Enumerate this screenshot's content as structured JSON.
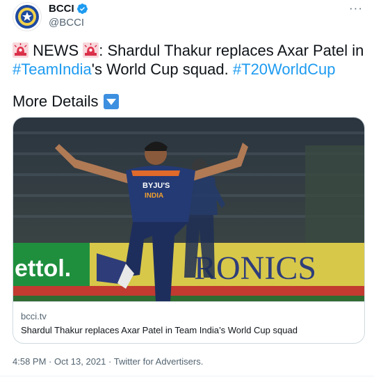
{
  "author": {
    "name": "BCCI",
    "handle": "@BCCI",
    "verified": true
  },
  "tweet": {
    "siren_icon": "police-car-light-emoji",
    "news_word": "NEWS",
    "headline": ": Shardul Thakur replaces Axar Patel in",
    "hashtag_team": "#TeamIndia",
    "after_hashtag": "'s World Cup squad.",
    "hashtag_event": "#T20WorldCup",
    "more_details": "More Details",
    "down_icon": "down-button-emoji"
  },
  "card": {
    "image_sign_left": "ettol.",
    "image_sign_right": "RONICS",
    "jersey_text": "BYJU'S",
    "jersey_text2": "INDIA",
    "domain": "bcci.tv",
    "title": "Shardul Thakur replaces Axar Patel in Team India’s World Cup squad"
  },
  "footer": {
    "timestamp": "4:58 PM · Oct 13, 2021 · Twitter for Advertisers."
  },
  "colors": {
    "link": "#1d9bf0",
    "secondary_text": "#536471",
    "verified": "#1d9bf0"
  }
}
